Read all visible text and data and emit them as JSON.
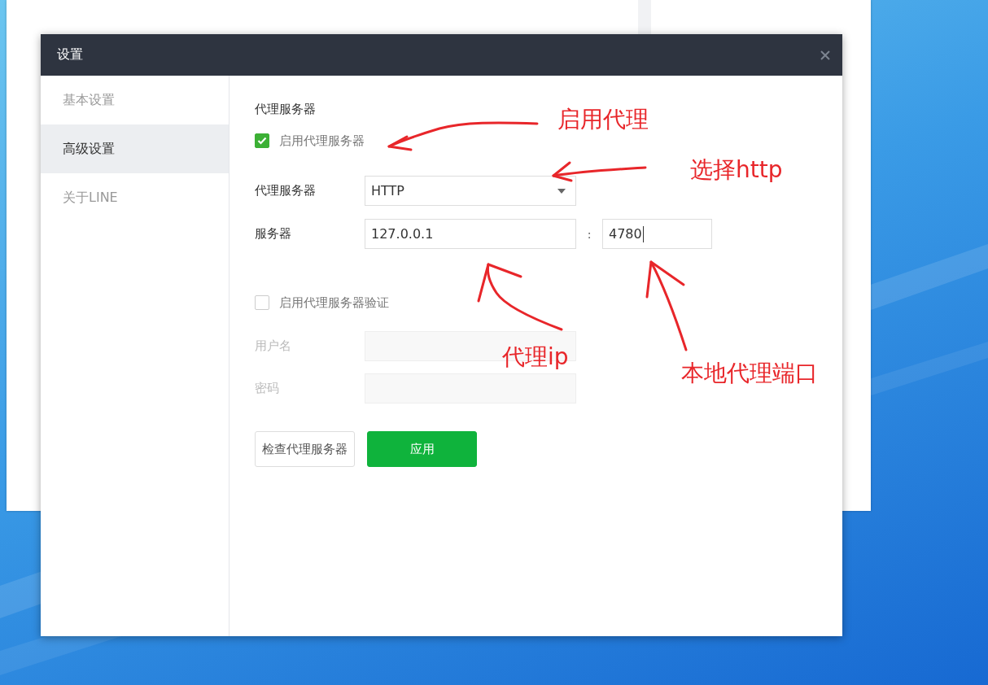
{
  "window": {
    "title": "设置"
  },
  "sidebar": {
    "items": [
      {
        "label": "基本设置",
        "selected": false
      },
      {
        "label": "高级设置",
        "selected": true
      },
      {
        "label": "关于LINE",
        "selected": false
      }
    ]
  },
  "proxy": {
    "heading": "代理服务器",
    "enable": {
      "label": "启用代理服务器",
      "checked": true
    },
    "type": {
      "label": "代理服务器",
      "value": "HTTP"
    },
    "server": {
      "label": "服务器",
      "host": "127.0.0.1",
      "separator": ":",
      "port": "4780"
    },
    "auth": {
      "label": "启用代理服务器验证",
      "checked": false
    },
    "username": {
      "label": "用户名",
      "disabled": true
    },
    "password": {
      "label": "密码",
      "disabled": true
    },
    "buttons": [
      {
        "label": "检查代理服务器",
        "kind": "secondary"
      },
      {
        "label": "应用",
        "kind": "primary"
      }
    ]
  },
  "annotations": [
    {
      "text": "启用代理"
    },
    {
      "text": "选择http"
    },
    {
      "text": "代理ip"
    },
    {
      "text": "本地代理端口"
    }
  ]
}
